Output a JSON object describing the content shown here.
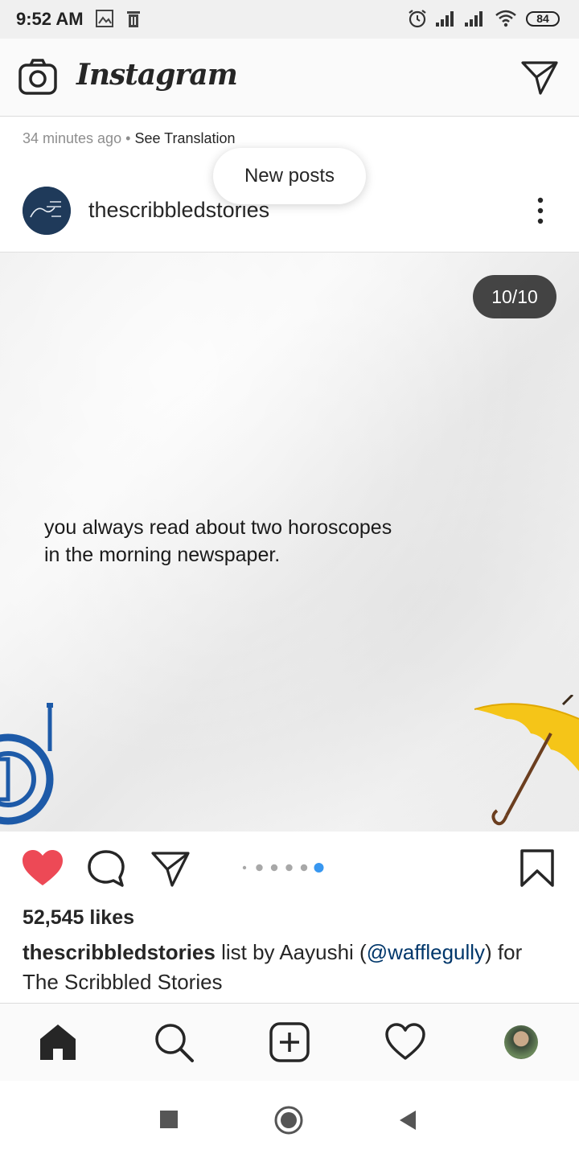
{
  "status_bar": {
    "time": "9:52 AM",
    "battery": "84",
    "icons": [
      "image-notification-icon",
      "trash-notification-icon",
      "alarm-icon",
      "signal-icon",
      "signal-icon",
      "wifi-icon",
      "battery-icon"
    ]
  },
  "header": {
    "app_name": "Instagram",
    "icons": [
      "camera-icon",
      "direct-message-icon"
    ]
  },
  "post": {
    "timestamp": "34 minutes ago",
    "separator": "•",
    "translation_link": "See Translation",
    "toast": "New posts",
    "author": "thescribbledstories",
    "avatar_text": "The Scribbled Stories",
    "counter": "10/10",
    "quote_line1": "you always read about two horoscopes",
    "quote_line2": "in the morning newspaper.",
    "carousel_total": 6,
    "carousel_active_index": 5,
    "liked": true,
    "likes_text": "52,545 likes",
    "caption": {
      "user": "thescribbledstories",
      "text_before": " list by Aayushi (",
      "mention": "@wafflegully",
      "text_after": ") for The Scribbled Stories"
    }
  },
  "colors": {
    "like_red": "#ed4956",
    "active_dot": "#3897f0",
    "mention": "#00376b",
    "horn_blue": "#1d5aa8",
    "umbrella_yellow": "#f5c518"
  },
  "bottom_nav": [
    "home-icon",
    "search-icon",
    "add-post-icon",
    "activity-heart-icon",
    "profile-avatar"
  ],
  "system_nav": [
    "recents-square-icon",
    "home-circle-icon",
    "back-triangle-icon"
  ]
}
